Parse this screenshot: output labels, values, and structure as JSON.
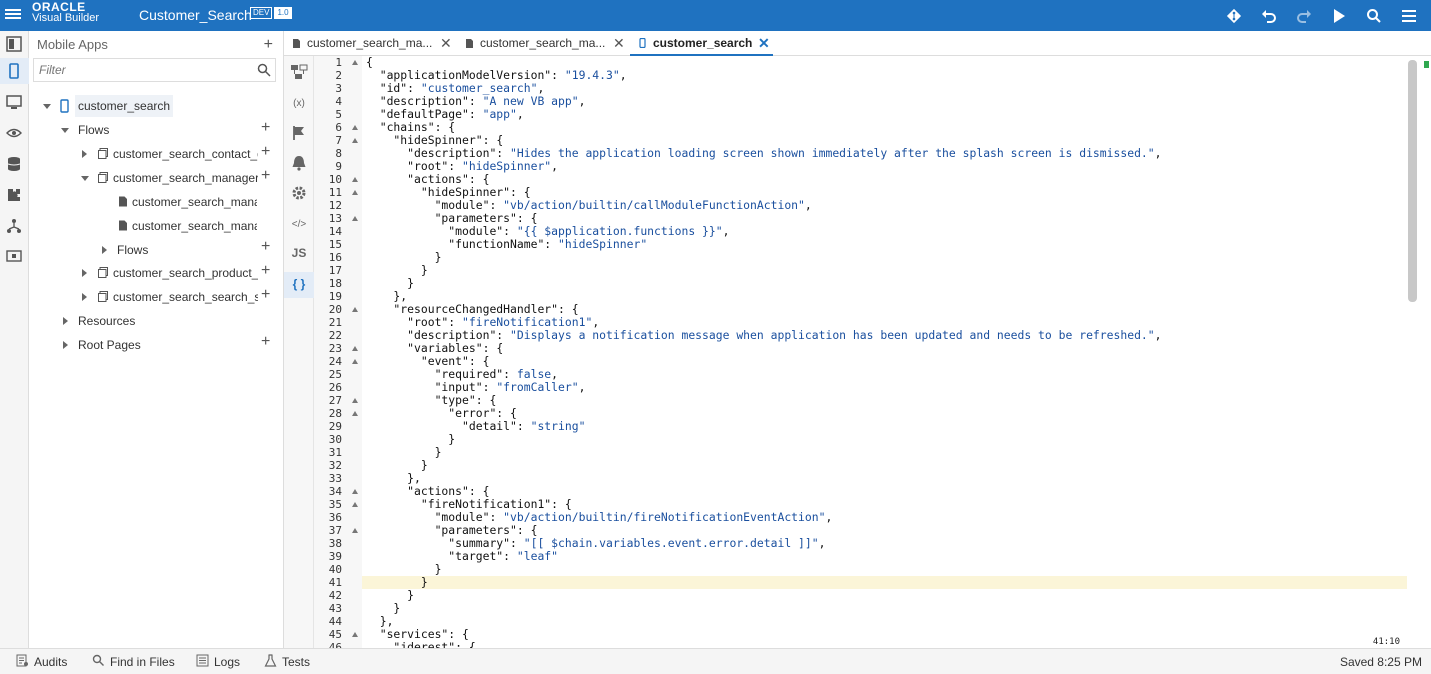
{
  "header": {
    "logo_line1": "ORACLE",
    "logo_line2": "Visual Builder",
    "app_title": "Customer_Search",
    "env_badge": "DEV",
    "version_badge": "1.0",
    "icons": [
      "menu-icon",
      "git-icon",
      "undo-icon",
      "redo-icon",
      "run-icon",
      "search-icon",
      "hamburger-menu-icon"
    ]
  },
  "activity_bar": {
    "icons": [
      "processes-icon",
      "mobile-apps-icon",
      "web-apps-icon",
      "service-connections-icon",
      "business-objects-icon",
      "components-icon",
      "source-icon",
      "artifacts-icon"
    ],
    "active": "mobile-apps-icon"
  },
  "navigator": {
    "title": "Mobile Apps",
    "filter_placeholder": "Filter",
    "tree": {
      "root": "customer_search",
      "flows": "Flows",
      "contact": "customer_search_contact_details",
      "manager": "customer_search_manager",
      "manager_page1": "customer_search_manager-start",
      "manager_page2": "customer_search_manager-flow",
      "sub_flows": "Flows",
      "product": "customer_search_product_page",
      "search": "customer_search_search_sales",
      "resources": "Resources",
      "root_pages": "Root Pages"
    }
  },
  "tabs": [
    {
      "label": "customer_search_ma...",
      "active": false
    },
    {
      "label": "customer_search_ma...",
      "active": false
    },
    {
      "label": "customer_search",
      "active": true
    }
  ],
  "tool_rail": {
    "icons": [
      "diagram-icon",
      "variables-icon",
      "action-chains-icon",
      "events-icon",
      "settings-icon",
      "html-source-icon",
      "js-source-icon",
      "json-source-icon"
    ],
    "labels": {
      "variables": "(x)",
      "html": "</>",
      "js": "JS",
      "json": "{ }"
    },
    "active": "json-source-icon"
  },
  "editor": {
    "cursor_position": "41:10",
    "current_line": 41,
    "lines": [
      "{",
      "  \"applicationModelVersion\": \"19.4.3\",",
      "  \"id\": \"customer_search\",",
      "  \"description\": \"A new VB app\",",
      "  \"defaultPage\": \"app\",",
      "  \"chains\": {",
      "    \"hideSpinner\": {",
      "      \"description\": \"Hides the application loading screen shown immediately after the splash screen is dismissed.\",",
      "      \"root\": \"hideSpinner\",",
      "      \"actions\": {",
      "        \"hideSpinner\": {",
      "          \"module\": \"vb/action/builtin/callModuleFunctionAction\",",
      "          \"parameters\": {",
      "            \"module\": \"{{ $application.functions }}\",",
      "            \"functionName\": \"hideSpinner\"",
      "          }",
      "        }",
      "      }",
      "    },",
      "    \"resourceChangedHandler\": {",
      "      \"root\": \"fireNotification1\",",
      "      \"description\": \"Displays a notification message when application has been updated and needs to be refreshed.\",",
      "      \"variables\": {",
      "        \"event\": {",
      "          \"required\": false,",
      "          \"input\": \"fromCaller\",",
      "          \"type\": {",
      "            \"error\": {",
      "              \"detail\": \"string\"",
      "            }",
      "          }",
      "        }",
      "      },",
      "      \"actions\": {",
      "        \"fireNotification1\": {",
      "          \"module\": \"vb/action/builtin/fireNotificationEventAction\",",
      "          \"parameters\": {",
      "            \"summary\": \"[[ $chain.variables.event.error.detail ]]\",",
      "            \"target\": \"leaf\"",
      "          }",
      "        }",
      "      }",
      "    }",
      "  },",
      "  \"services\": {",
      "    \"jderest\": {"
    ],
    "fold_lines": [
      1,
      6,
      7,
      10,
      11,
      13,
      20,
      23,
      24,
      27,
      28,
      34,
      35,
      37,
      45
    ]
  },
  "footer": {
    "audits": "Audits",
    "find_in_files": "Find in Files",
    "logs": "Logs",
    "tests": "Tests",
    "status": "Saved 8:25 PM"
  },
  "colors": {
    "header_bg": "#1f72c0",
    "string": "#1a4f9e",
    "current_line": "#fbf5d8"
  }
}
